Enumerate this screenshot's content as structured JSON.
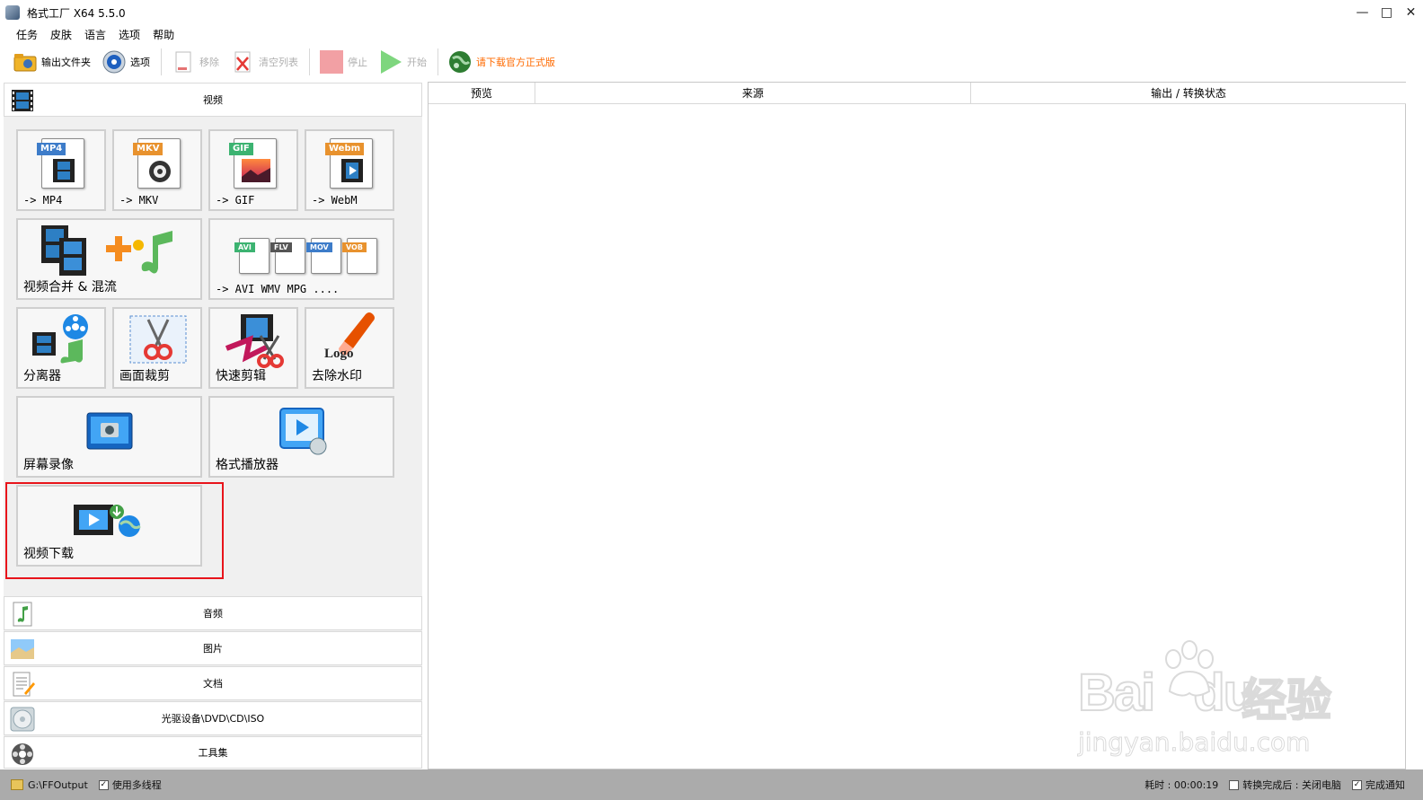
{
  "window": {
    "title": "格式工厂 X64 5.5.0"
  },
  "menu": [
    "任务",
    "皮肤",
    "语言",
    "选项",
    "帮助"
  ],
  "toolbar": {
    "output_folder": "输出文件夹",
    "options": "选项",
    "remove": "移除",
    "clear_list": "清空列表",
    "stop": "停止",
    "start": "开始",
    "promo": "请下载官方正式版"
  },
  "categories": {
    "video": "视频",
    "audio": "音频",
    "image": "图片",
    "document": "文档",
    "disc": "光驱设备\\DVD\\CD\\ISO",
    "tools": "工具集"
  },
  "video_tiles": {
    "mp4": {
      "label": "-> MP4",
      "tag": "MP4"
    },
    "mkv": {
      "label": "-> MKV",
      "tag": "MKV"
    },
    "gif": {
      "label": "-> GIF",
      "tag": "GIF"
    },
    "webm": {
      "label": "-> WebM",
      "tag": "Webm"
    },
    "merge": {
      "label": "视频合并 & 混流"
    },
    "others": {
      "label": "-> AVI WMV MPG ....",
      "tags": [
        "AVI",
        "FLV",
        "MOV",
        "VOB"
      ]
    },
    "splitter": {
      "label": "分离器"
    },
    "crop": {
      "label": "画面裁剪"
    },
    "quick_edit": {
      "label": "快速剪辑"
    },
    "remove_watermark": {
      "label": "去除水印",
      "logo_text": "Logo"
    },
    "screen_record": {
      "label": "屏幕录像"
    },
    "player": {
      "label": "格式播放器"
    },
    "download": {
      "label": "视频下载"
    }
  },
  "list_columns": [
    "预览",
    "来源",
    "输出 / 转换状态"
  ],
  "statusbar": {
    "path": "G:\\FFOutput",
    "multithread": "使用多线程",
    "elapsed": "耗时 : 00:00:19",
    "after_convert": "转换完成后 : 关闭电脑",
    "notify": "完成通知"
  },
  "watermark": {
    "brand_left": "Bai",
    "brand_right": "du",
    "brand_cn": "经验",
    "url": "jingyan.baidu.com"
  },
  "colors": {
    "highlight": "#e8141b",
    "promo": "#ff6a00",
    "statusbar": "#ababab"
  }
}
